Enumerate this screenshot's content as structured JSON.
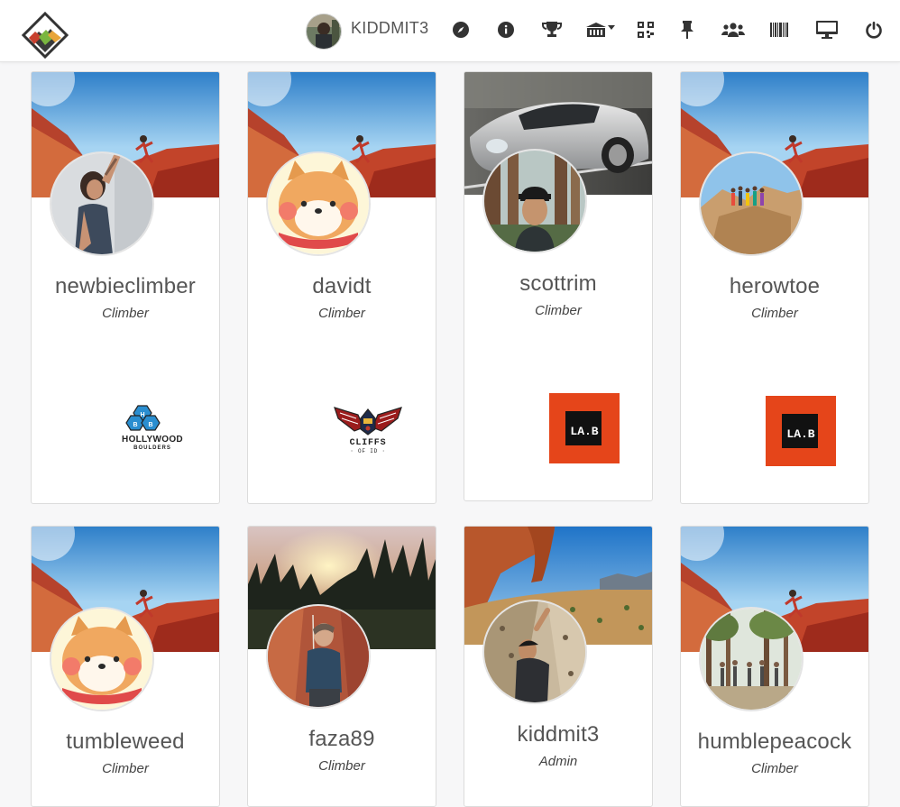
{
  "navbar": {
    "username": "KIDDMIT3",
    "icons": [
      {
        "name": "compass-icon"
      },
      {
        "name": "info-icon"
      },
      {
        "name": "trophy-icon"
      },
      {
        "name": "gym-dropdown-icon"
      },
      {
        "name": "qr-code-icon"
      },
      {
        "name": "pin-icon"
      },
      {
        "name": "users-icon"
      },
      {
        "name": "barcode-icon"
      },
      {
        "name": "monitor-icon"
      },
      {
        "name": "power-icon"
      }
    ]
  },
  "cards": [
    {
      "username": "newbieclimber",
      "role": "Climber",
      "gym": "Hollywood Boulders",
      "gym_logo_text": "HOLLYWOOD",
      "gym_logo_sub": "BOULDERS"
    },
    {
      "username": "davidt",
      "role": "Climber",
      "gym": "Cliffs of ID",
      "gym_logo_text": "CLIFFS",
      "gym_logo_sub": "· OF ID ·"
    },
    {
      "username": "scottrim",
      "role": "Climber",
      "gym": "LA Boulders",
      "gym_logo_text": "LA.B"
    },
    {
      "username": "herowtoe",
      "role": "Climber",
      "gym": "LA Boulders",
      "gym_logo_text": "LA.B"
    },
    {
      "username": "tumbleweed",
      "role": "Climber"
    },
    {
      "username": "faza89",
      "role": "Climber"
    },
    {
      "username": "kiddmit3",
      "role": "Admin"
    },
    {
      "username": "humblepeacock",
      "role": "Climber"
    }
  ],
  "colors": {
    "lab_orange": "#e5451a",
    "text_gray": "#555555"
  }
}
